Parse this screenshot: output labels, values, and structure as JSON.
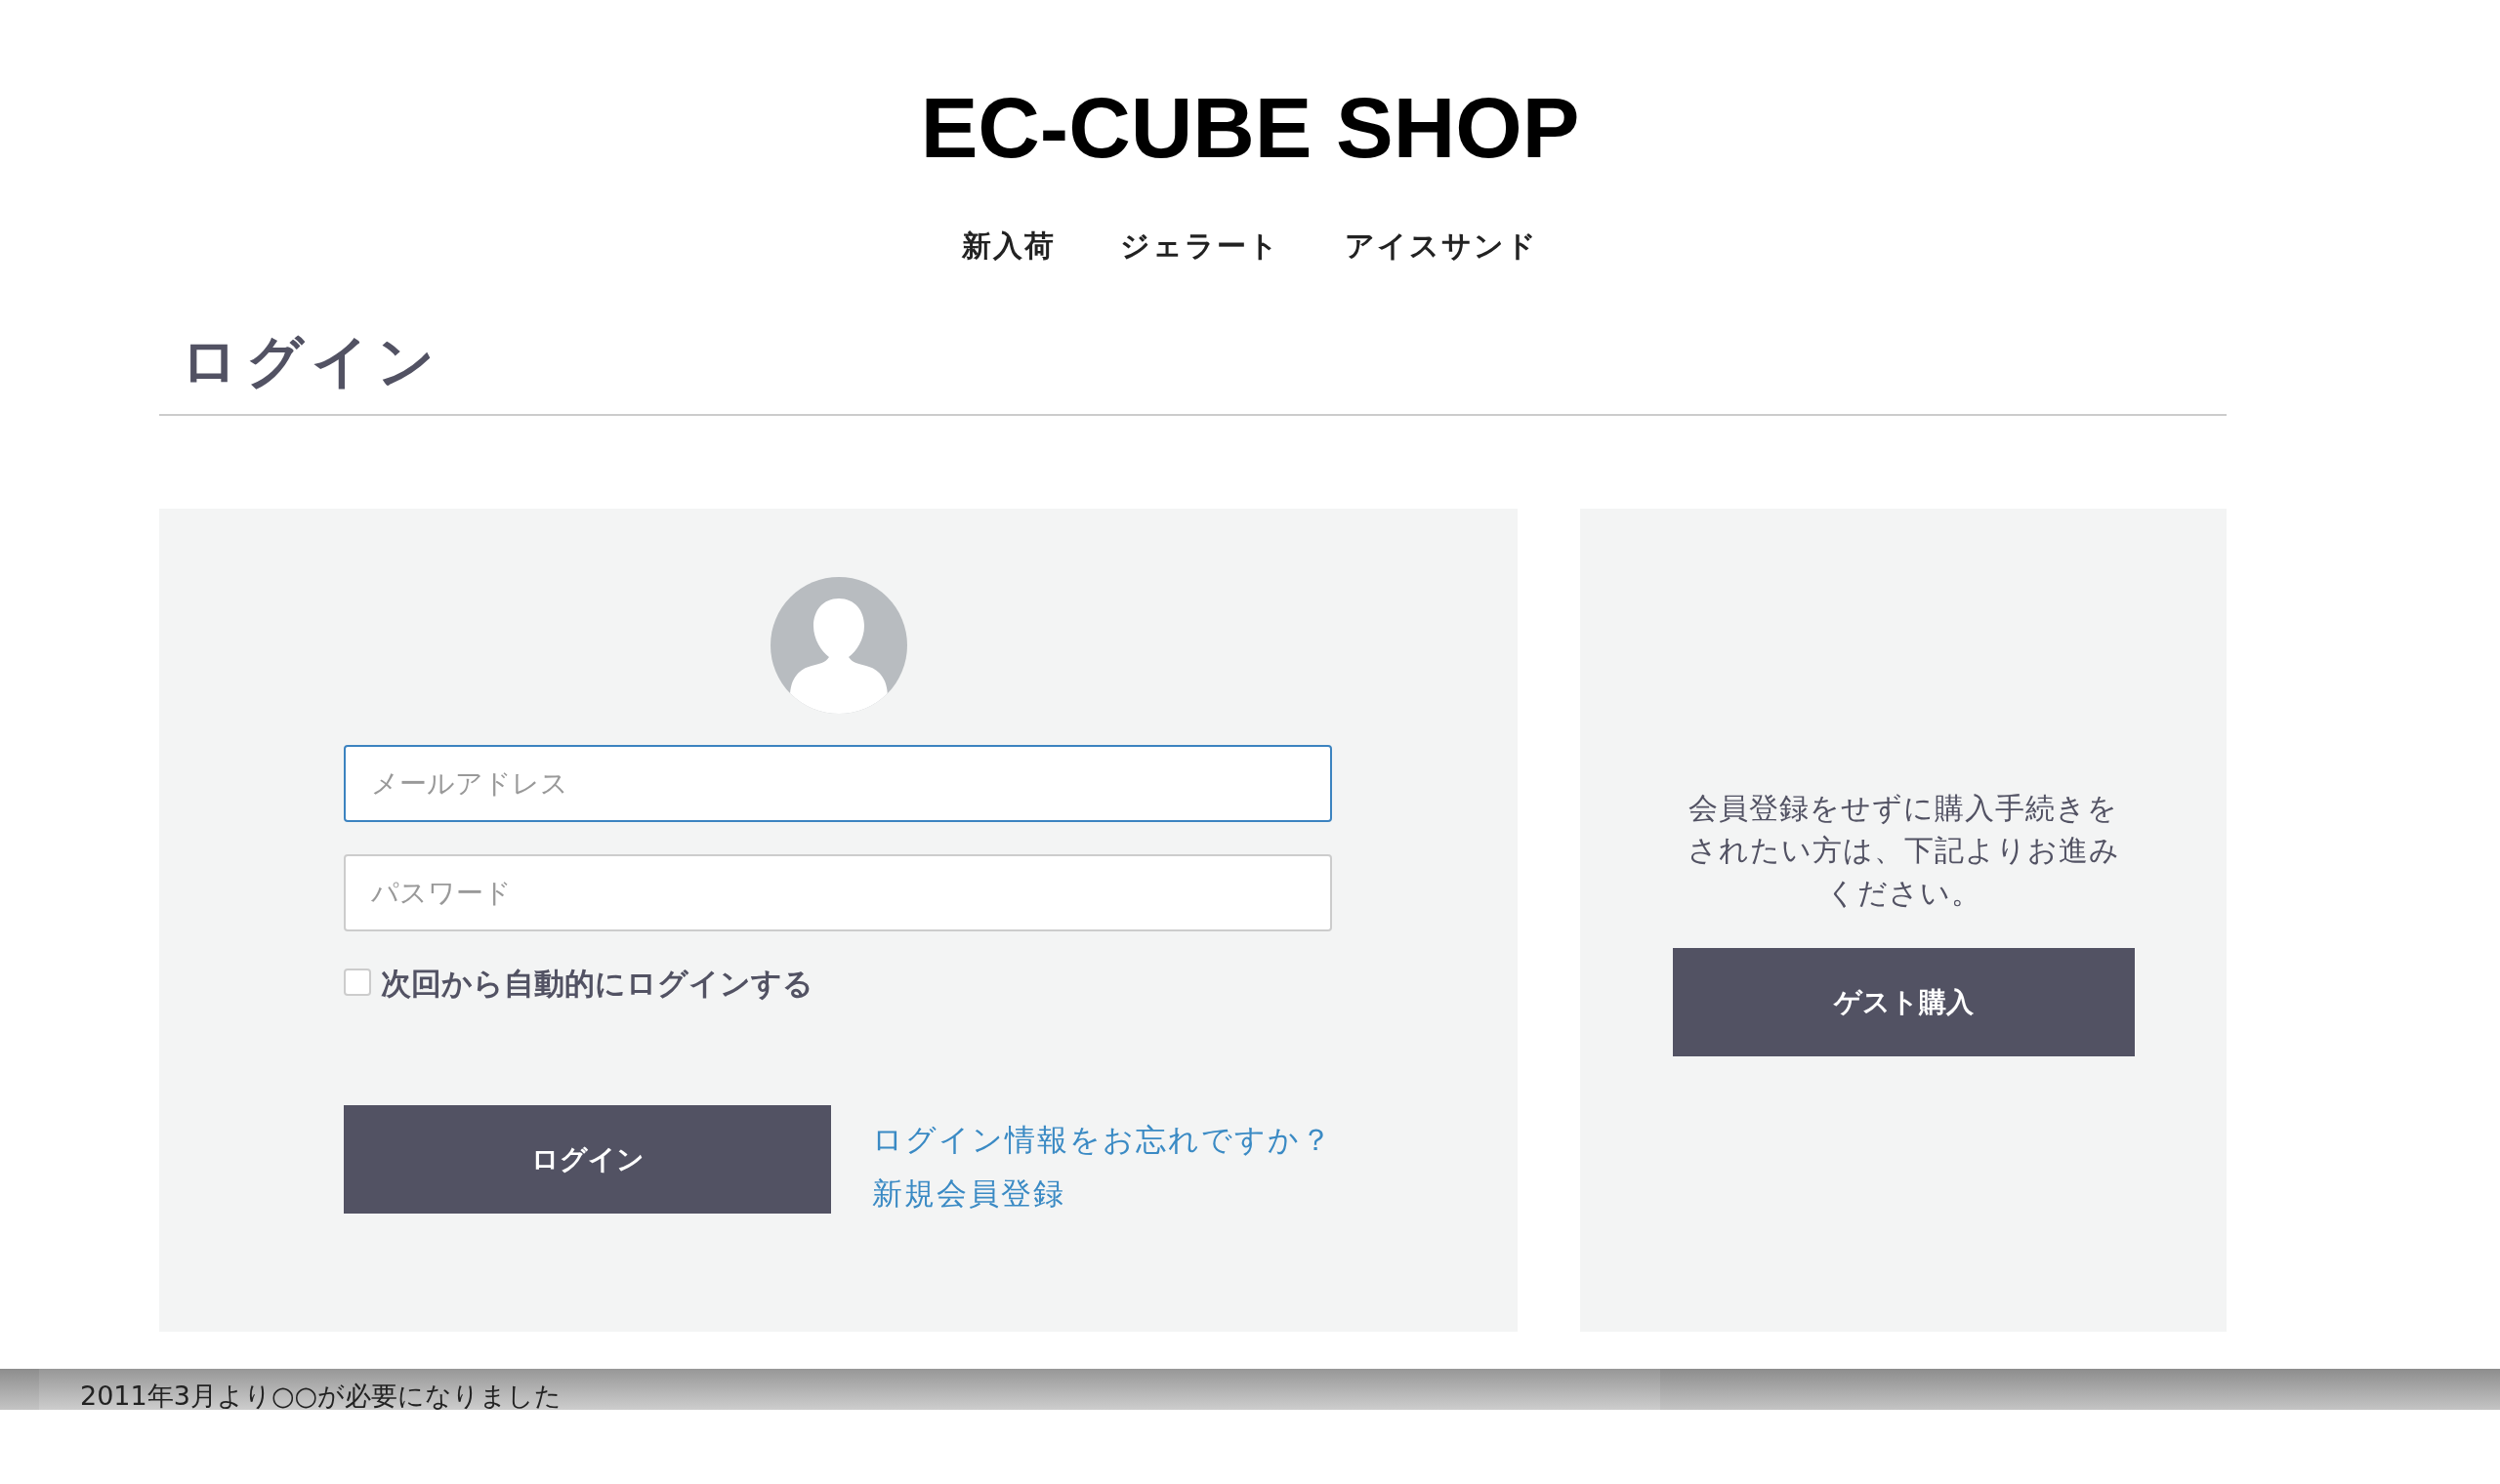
{
  "header": {
    "shop_title": "EC-CUBE SHOP",
    "nav": [
      "新入荷",
      "ジェラート",
      "アイスサンド"
    ]
  },
  "page_title": "ログイン",
  "login_form": {
    "email": {
      "placeholder": "メールアドレス",
      "focused": true
    },
    "password": {
      "placeholder": "パスワード",
      "focused": false
    },
    "remember_me": {
      "label": "次回から自動的にログインする",
      "checked": false
    },
    "submit": "ログイン",
    "links": [
      "ログイン情報をお忘れですか？",
      "新規会員登録"
    ]
  },
  "guest": {
    "message": "会員登録をせずに購入手続きをされたい方は、下記よりお進みください。",
    "button": "ゲスト購入"
  },
  "notice_bar": {
    "text": "2011年3月より○○が必要になりました"
  }
}
